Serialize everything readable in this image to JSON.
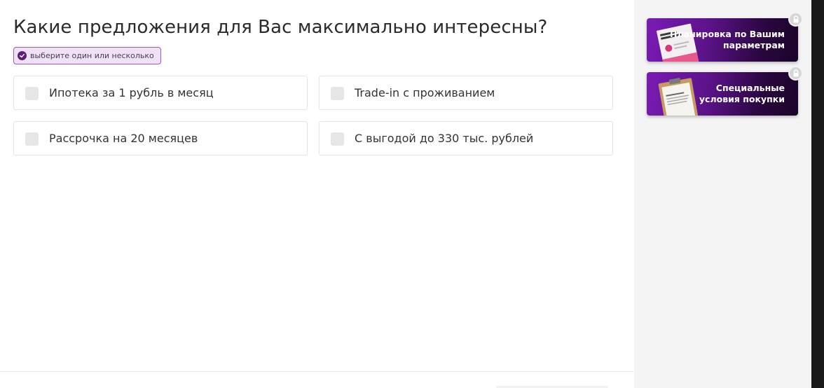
{
  "question": {
    "title": "Какие предложения для Вас максимально интересны?",
    "hint": "выберите один или несколько"
  },
  "options": [
    {
      "label": "Ипотека за 1 рубль в месяц",
      "checked": false
    },
    {
      "label": "Trade-in с проживанием",
      "checked": false
    },
    {
      "label": "Рассрочка на 20 месяцев",
      "checked": false
    },
    {
      "label": "С выгодой до 330 тыс. рублей",
      "checked": false
    }
  ],
  "bonuses": [
    {
      "text": "Планировка по Вашим\nпараметрам",
      "locked": true,
      "icon": "brochure-image"
    },
    {
      "text": "Специальные\nусловия покупки",
      "locked": true,
      "icon": "clipboard-image"
    }
  ],
  "colors": {
    "accent": "#5c1f75",
    "badge_bg": "#f0e2f6",
    "badge_border": "#a653c6",
    "card_gradient_start": "#7a1bb5",
    "card_gradient_end": "#1a0428",
    "sidebar_bg": "#f4f4f4"
  }
}
